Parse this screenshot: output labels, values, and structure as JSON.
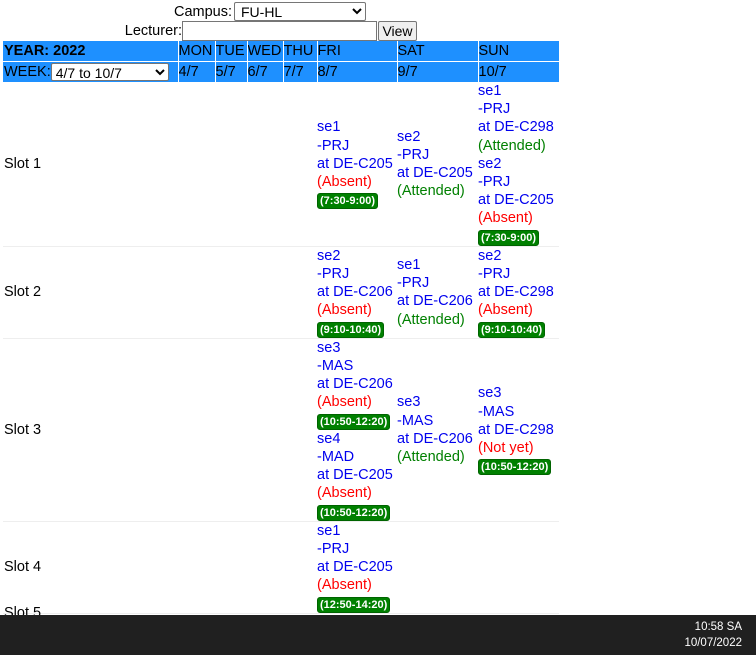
{
  "filters": {
    "campus_label": "Campus:",
    "campus_value": "FU-HL",
    "lecturer_label": "Lecturer:",
    "lecturer_value": "",
    "view_label": "View"
  },
  "header": {
    "year_label": "YEAR: 2022",
    "week_label": "WEEK:",
    "week_value": "4/7 to 10/7",
    "days": [
      "MON",
      "TUE",
      "WED",
      "THU",
      "FRI",
      "SAT",
      "SUN"
    ],
    "dates": [
      "4/7",
      "5/7",
      "6/7",
      "7/7",
      "8/7",
      "9/7",
      "10/7"
    ]
  },
  "slots": [
    {
      "label": "Slot 1",
      "fri": [
        {
          "group": "se1",
          "course": "-PRJ",
          "room": "at DE-C205",
          "status": "(Absent)",
          "time": "(7:30-9:00)"
        }
      ],
      "sat": [
        {
          "group": "se2",
          "course": "-PRJ",
          "room": "at DE-C205",
          "status": "(Attended)"
        }
      ],
      "sun": [
        {
          "group": "se1",
          "course": "-PRJ",
          "room": "at DE-C298",
          "status": "(Attended)"
        },
        {
          "group": "se2",
          "course": "-PRJ",
          "room": "at DE-C205",
          "status": "(Absent)",
          "time": "(7:30-9:00)"
        }
      ]
    },
    {
      "label": "Slot 2",
      "fri": [
        {
          "group": "se2",
          "course": "-PRJ",
          "room": "at DE-C206",
          "status": "(Absent)",
          "time": "(9:10-10:40)"
        }
      ],
      "sat": [
        {
          "group": "se1",
          "course": "-PRJ",
          "room": "at DE-C206",
          "status": "(Attended)"
        }
      ],
      "sun": [
        {
          "group": "se2",
          "course": "-PRJ",
          "room": "at DE-C298",
          "status": "(Absent)",
          "time": "(9:10-10:40)"
        }
      ]
    },
    {
      "label": "Slot 3",
      "fri": [
        {
          "group": "se3",
          "course": "-MAS",
          "room": "at DE-C206",
          "status": "(Absent)",
          "time": "(10:50-12:20)"
        },
        {
          "group": "se4",
          "course": "-MAD",
          "room": "at DE-C205",
          "status": "(Absent)",
          "time": "(10:50-12:20)"
        }
      ],
      "sat": [
        {
          "group": "se3",
          "course": "-MAS",
          "room": "at DE-C206",
          "status": "(Attended)"
        }
      ],
      "sun": [
        {
          "group": "se3",
          "course": "-MAS",
          "room": "at DE-C298",
          "status": "(Not yet)",
          "time": "(10:50-12:20)"
        }
      ]
    },
    {
      "label": "Slot 4",
      "fri": [
        {
          "group": "se1",
          "course": "-PRJ",
          "room": "at DE-C205",
          "status": "(Absent)",
          "time": "(12:50-14:20)"
        }
      ],
      "sat": [],
      "sun": []
    }
  ],
  "clipped_slot_label": "Slot 5",
  "taskbar": {
    "time": "10:58 SA",
    "date": "10/07/2022"
  },
  "colors": {
    "header_bg": "#1e90ff",
    "entry_text": "#0000ee",
    "absent": "#ff0000",
    "attended": "#008000",
    "time_badge": "#008000",
    "taskbar_bg": "#202020"
  }
}
